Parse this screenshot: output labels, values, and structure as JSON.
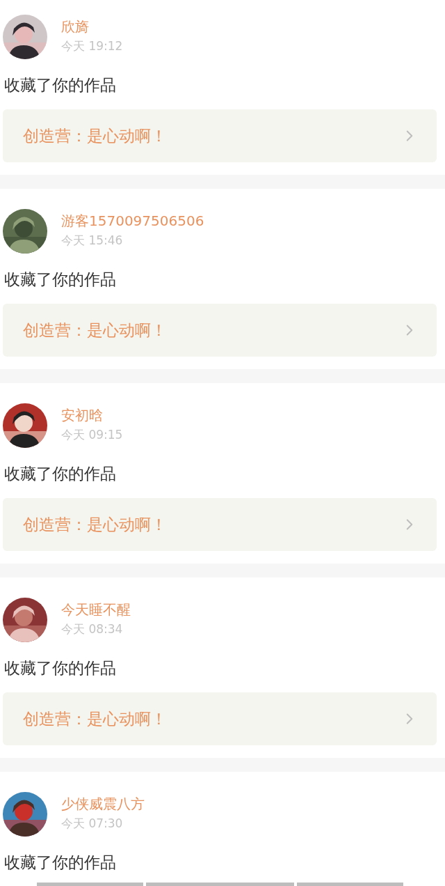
{
  "notifications": [
    {
      "user_name": "欣旖",
      "time": "今天 19:12",
      "action": "收藏了你的作品",
      "work_title": "创造营：是心动啊！"
    },
    {
      "user_name": "游客1570097506506",
      "time": "今天 15:46",
      "action": "收藏了你的作品",
      "work_title": "创造营：是心动啊！"
    },
    {
      "user_name": "安初晗",
      "time": "今天 09:15",
      "action": "收藏了你的作品",
      "work_title": "创造营：是心动啊！"
    },
    {
      "user_name": "今天睡不醒",
      "time": "今天 08:34",
      "action": "收藏了你的作品",
      "work_title": "创造营：是心动啊！"
    },
    {
      "user_name": "少侠威震八方",
      "time": "今天 07:30",
      "action": "收藏了你的作品"
    }
  ]
}
